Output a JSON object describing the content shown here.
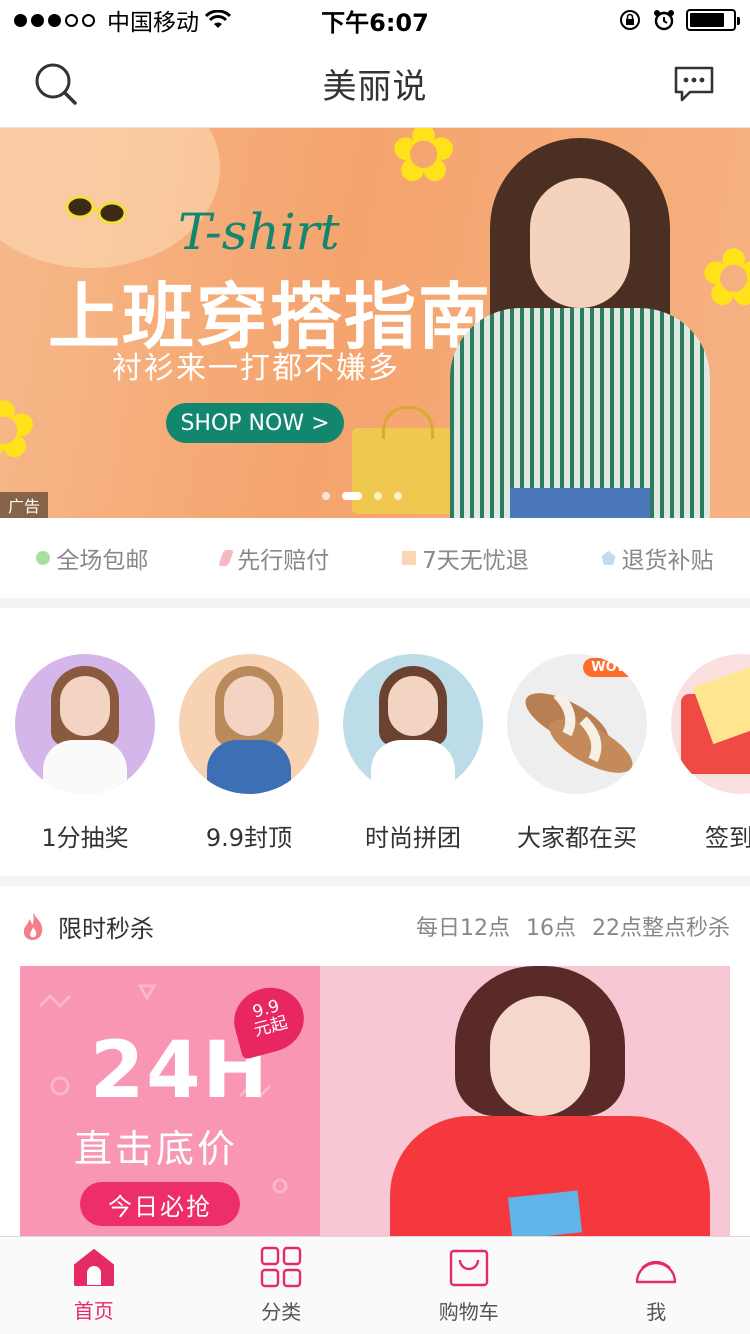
{
  "status_bar": {
    "carrier": "中国移动",
    "time": "下午6:07"
  },
  "nav": {
    "title": "美丽说",
    "left_icon": "search-icon",
    "right_icon": "message-icon"
  },
  "banner": {
    "title_en": "T-shirt",
    "title": "上班穿搭指南",
    "slogan": "衬衫来一打都不嫌多",
    "button": "SHOP NOW >",
    "ad_tag": "广告",
    "slide_count": 4,
    "active_slide": 2
  },
  "guarantees": [
    {
      "label": "全场包邮",
      "color": "#a9e0a1"
    },
    {
      "label": "先行赔付",
      "color": "#f6b9c0"
    },
    {
      "label": "7天无忧退",
      "color": "#fbd6b6"
    },
    {
      "label": "退货补贴",
      "color": "#c3d8f5"
    }
  ],
  "categories": [
    {
      "label": "1分抽奖"
    },
    {
      "label": "9.9封顶"
    },
    {
      "label": "时尚拼团"
    },
    {
      "label": "大家都在买",
      "badge": "WOW"
    },
    {
      "label": "签到领"
    }
  ],
  "flash_sale": {
    "title": "限时秒杀",
    "times": [
      "每日12点",
      "16点",
      "22点整点秒杀"
    ],
    "card": {
      "headline": "24H",
      "subline": "直击底价",
      "button": "今日必抢",
      "badge_line1": "9.9",
      "badge_line2": "元起"
    }
  },
  "tab_bar": [
    {
      "label": "首页",
      "icon": "home-icon",
      "active": true
    },
    {
      "label": "分类",
      "icon": "category-grid-icon",
      "active": false
    },
    {
      "label": "购物车",
      "icon": "shopping-bag-icon",
      "active": false
    },
    {
      "label": "我",
      "icon": "profile-icon",
      "active": false
    }
  ],
  "colors": {
    "accent": "#e52b63",
    "banner_green": "#13866f"
  }
}
